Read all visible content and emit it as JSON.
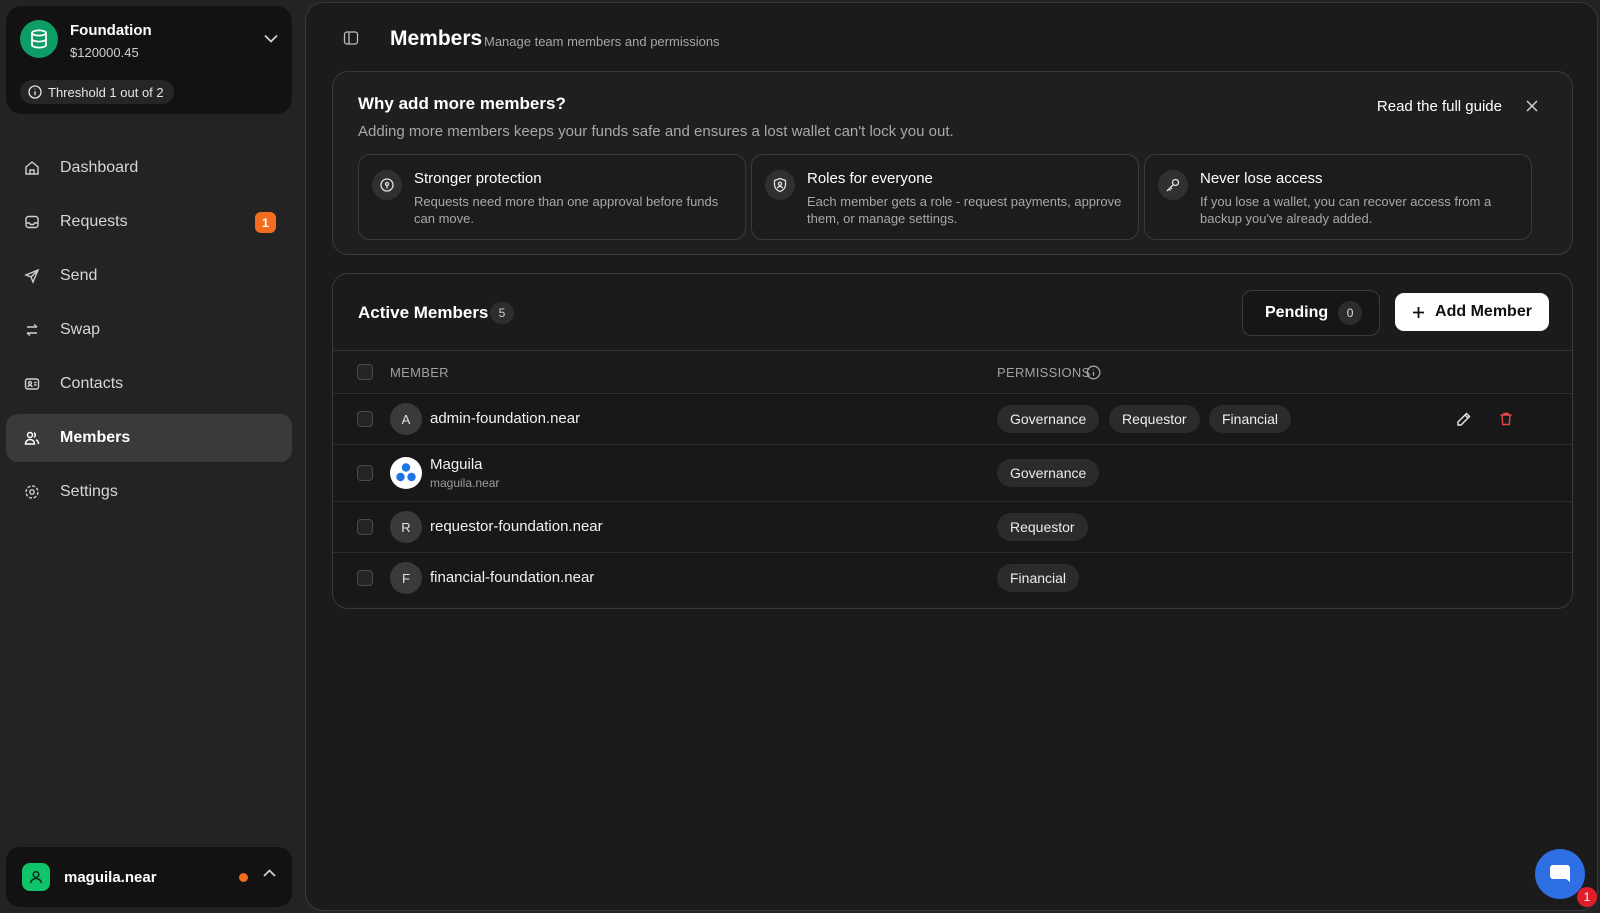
{
  "org": {
    "name": "Foundation",
    "balance": "$120000.45",
    "threshold": "Threshold 1 out of 2",
    "logo_color": "#0f9d67"
  },
  "nav": {
    "items": [
      {
        "label": "Dashboard",
        "icon": "home-icon"
      },
      {
        "label": "Requests",
        "icon": "inbox-icon",
        "badge": "1"
      },
      {
        "label": "Send",
        "icon": "send-icon"
      },
      {
        "label": "Swap",
        "icon": "swap-icon"
      },
      {
        "label": "Contacts",
        "icon": "contact-card-icon"
      },
      {
        "label": "Members",
        "icon": "users-icon",
        "active": true
      },
      {
        "label": "Settings",
        "icon": "gear-icon"
      }
    ]
  },
  "user": {
    "name": "maguila.near",
    "status_color": "#f26d1d"
  },
  "header": {
    "title": "Members",
    "subtitle": "Manage team members and permissions"
  },
  "guide": {
    "title": "Why add more members?",
    "description": "Adding more members keeps your funds safe and ensures a lost wallet can't lock you out.",
    "link": "Read the full guide",
    "features": [
      {
        "title": "Stronger protection",
        "description": "Requests need more than one approval before funds can move.",
        "icon": "lock-icon"
      },
      {
        "title": "Roles for everyone",
        "description": "Each member gets a role - request payments, approve them, or manage settings.",
        "icon": "shield-user-icon"
      },
      {
        "title": "Never lose access",
        "description": "If you lose a wallet, you can recover access from a backup you've already added.",
        "icon": "key-icon"
      }
    ]
  },
  "members": {
    "title": "Active Members",
    "count": "5",
    "pending_label": "Pending",
    "pending_count": "0",
    "add_label": "Add Member",
    "columns": {
      "member": "MEMBER",
      "permissions": "PERMISSIONS"
    },
    "rows": [
      {
        "initial": "A",
        "name": "admin-foundation.near",
        "sub": "",
        "permissions": [
          "Governance",
          "Requestor",
          "Financial"
        ]
      },
      {
        "initial": "",
        "name": "Maguila",
        "sub": "maguila.near",
        "permissions": [
          "Governance"
        ]
      },
      {
        "initial": "R",
        "name": "requestor-foundation.near",
        "sub": "",
        "permissions": [
          "Requestor"
        ]
      },
      {
        "initial": "F",
        "name": "financial-foundation.near",
        "sub": "",
        "permissions": [
          "Financial"
        ]
      }
    ]
  },
  "chat": {
    "badge": "1",
    "color": "#2f6fe4"
  },
  "colors": {
    "accent_orange": "#f26d1d",
    "danger": "#e5484d"
  }
}
